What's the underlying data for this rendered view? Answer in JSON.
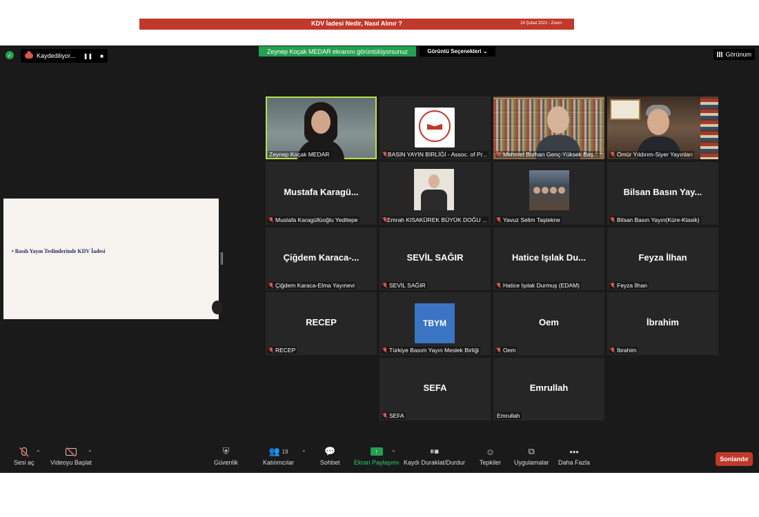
{
  "banner": {
    "title": "KDV İadesi Nedir, Nasıl Alınır ?",
    "date": "24 Şubat 2022 - Zoom"
  },
  "topbar": {
    "recording_label": "Kaydediliyor...",
    "sharing_notice": "Zeynep Koçak MEDAR ekranını görüntülüyorsunuz",
    "view_options": "Görüntü Seçenekleri ⌄",
    "view_label": "Görünum"
  },
  "slide": {
    "bullet": "• Basılı Yayın Teslimlerinde KDV İadesi"
  },
  "tiles": [
    {
      "name": "Zeynep Koçak MEDAR",
      "big": "",
      "muted": false
    },
    {
      "name": "BASIN YAYIN BİRLİĞİ - Assoc. of Pr...",
      "big": "",
      "muted": true
    },
    {
      "name": "Mehmet Burhan Genç-Yüksek Baş...",
      "big": "",
      "muted": true
    },
    {
      "name": "Ömür Yıldırım-Siyer Yayınları",
      "big": "",
      "muted": true
    },
    {
      "name": "Mustafa Karagüllüoğlu Yeditepe",
      "big": "Mustafa Karagü...",
      "muted": true
    },
    {
      "name": "Emrah KISAKÜREK BÜYÜK DOĞU ...",
      "big": "",
      "muted": true
    },
    {
      "name": "Yavuz Selim Taştekne",
      "big": "",
      "muted": true
    },
    {
      "name": "Bilsan Basın Yayın(Küre-Klasik)",
      "big": "Bilsan  Basın  Yay...",
      "muted": true
    },
    {
      "name": "Çiğdem Karaca-Elma Yayınevi",
      "big": "Çiğdem  Karaca-...",
      "muted": true
    },
    {
      "name": "SEVİL SAĞIR",
      "big": "SEVİL SAĞIR",
      "muted": true
    },
    {
      "name": "Hatice Işılak Durmuş (EDAM)",
      "big": "Hatice  Işılak  Du...",
      "muted": true
    },
    {
      "name": "Feyza İlhan",
      "big": "Feyza İlhan",
      "muted": true
    },
    {
      "name": "RECEP",
      "big": "RECEP",
      "muted": true
    },
    {
      "name": "Türkiye Basım Yayın Meslek Birliği",
      "big": "",
      "muted": true
    },
    {
      "name": "Oem",
      "big": "Oem",
      "muted": true
    },
    {
      "name": "İbrahim",
      "big": "İbrahim",
      "muted": true
    },
    {
      "name": "SEFA",
      "big": "SEFA",
      "muted": true
    },
    {
      "name": "Emrullah",
      "big": "Emrullah",
      "muted": false
    }
  ],
  "taym_logo_text": "TBYM",
  "toolbar": {
    "mute": "Sesi aç",
    "video": "Videoyu Başlat",
    "security": "Güvenlik",
    "participants": "Katılımcılar",
    "participant_count": "19",
    "chat": "Sohbet",
    "share": "Ekran Paylaşımı",
    "record": "Kaydı Duraklat/Durdur",
    "reactions": "Tepkiler",
    "apps": "Uygulamalar",
    "more": "Daha Fazla",
    "end": "Sonlandır"
  },
  "colors": {
    "accent_green": "#23a14f",
    "end_red": "#c0392b",
    "active_speaker": "#b8e04a",
    "banner_red": "#c0392b"
  }
}
